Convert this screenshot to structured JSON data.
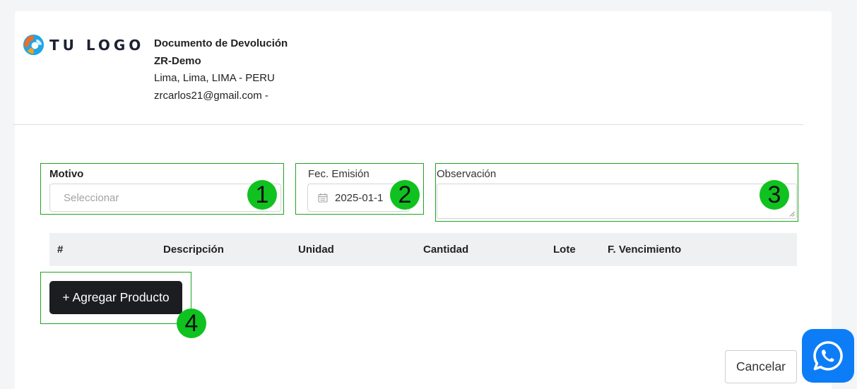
{
  "header": {
    "logo_text": "TU LOGO",
    "document_title": "Documento de Devolución",
    "company_name": "ZR-Demo",
    "address": "Lima, Lima, LIMA - PERU",
    "email": "zrcarlos21@gmail.com -"
  },
  "form": {
    "motivo": {
      "label": "Motivo",
      "placeholder": "Seleccionar"
    },
    "fecha": {
      "label": "Fec. Emisión",
      "value": "2025-01-1"
    },
    "observacion": {
      "label": "Observación",
      "value": ""
    }
  },
  "annotations": [
    "1",
    "2",
    "3",
    "4"
  ],
  "table": {
    "columns": [
      "#",
      "Descripción",
      "Unidad",
      "Cantidad",
      "Lote",
      "F. Vencimiento"
    ]
  },
  "buttons": {
    "add_product": "+ Agregar Producto",
    "cancel": "Cancelar"
  },
  "icons": {
    "calendar": "calendar-icon",
    "whatsapp": "whatsapp-icon",
    "logo": "logo-icon"
  },
  "colors": {
    "annotation_box": "#21a321",
    "annotation_badge": "#0fc21f",
    "primary_button": "#1c1d21",
    "whatsapp": "#0d7df7"
  }
}
